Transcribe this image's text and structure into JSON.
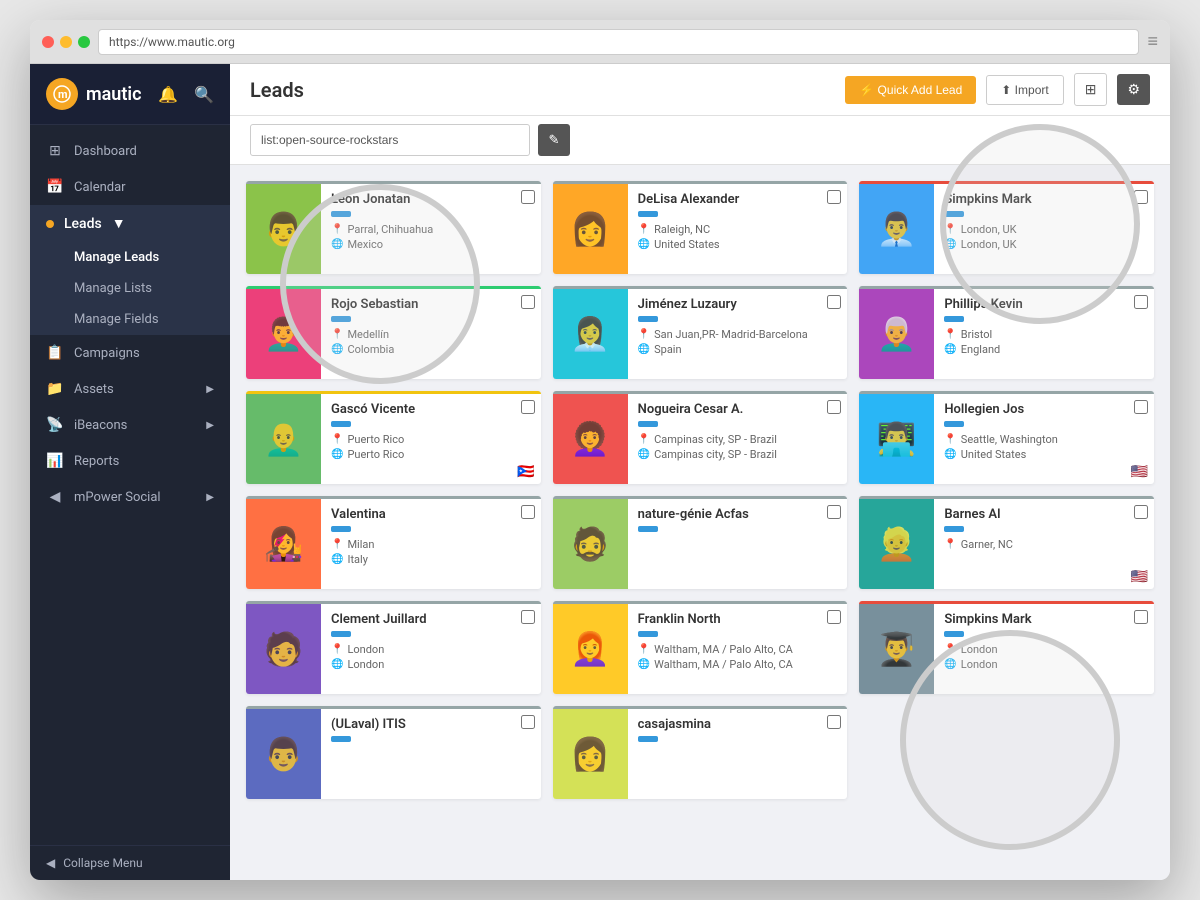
{
  "browser": {
    "url": "https://www.mautic.org"
  },
  "app": {
    "name": "mautic",
    "logo_letter": "m"
  },
  "header": {
    "title": "Leads",
    "quick_add_label": "⚡ Quick Add Lead",
    "import_label": "⬆ Import",
    "grid_icon": "⊞",
    "settings_icon": "⚙"
  },
  "search": {
    "value": "list:open-source-rockstars",
    "edit_icon": "✎"
  },
  "sidebar": {
    "logo": "mautic",
    "nav_items": [
      {
        "id": "dashboard",
        "label": "Dashboard",
        "icon": "⊞"
      },
      {
        "id": "calendar",
        "label": "Calendar",
        "icon": "📅"
      },
      {
        "id": "leads",
        "label": "Leads",
        "icon": "👤",
        "has_arrow": true,
        "active": true
      },
      {
        "id": "campaigns",
        "label": "Campaigns",
        "icon": "📋"
      },
      {
        "id": "assets",
        "label": "Assets",
        "icon": "📁",
        "has_arrow": true
      },
      {
        "id": "ibeacons",
        "label": "iBeacons",
        "icon": "📡",
        "has_arrow": true
      },
      {
        "id": "reports",
        "label": "Reports",
        "icon": "📊"
      },
      {
        "id": "mpower-social",
        "label": "mPower Social",
        "icon": "◀",
        "has_arrow": true
      }
    ],
    "leads_sub": [
      {
        "id": "manage-leads",
        "label": "Manage Leads",
        "active": true
      },
      {
        "id": "manage-lists",
        "label": "Manage Lists",
        "active": false
      },
      {
        "id": "manage-fields",
        "label": "Manage Fields",
        "active": false
      }
    ],
    "collapse_label": "Collapse Menu"
  },
  "leads": [
    {
      "id": 1,
      "name": "Leon Jonatan",
      "city": "Parral, Chihuahua",
      "country": "Mexico",
      "border": "border-gray",
      "flag": ""
    },
    {
      "id": 2,
      "name": "DeLisa Alexander",
      "city": "Raleigh, NC",
      "country": "United States",
      "border": "border-gray",
      "flag": ""
    },
    {
      "id": 3,
      "name": "Simpkins Mark",
      "city": "London, UK",
      "country": "London, UK",
      "border": "border-red",
      "flag": ""
    },
    {
      "id": 4,
      "name": "Rojo Sebastian",
      "city": "Medellín",
      "country": "Colombia",
      "border": "border-green",
      "flag": ""
    },
    {
      "id": 5,
      "name": "Jiménez Luzaury",
      "city": "San Juan,PR- Madrid-Barcelona",
      "country": "Spain",
      "border": "border-gray",
      "flag": ""
    },
    {
      "id": 6,
      "name": "Phillips Kevin",
      "city": "Bristol",
      "country": "England",
      "border": "border-gray",
      "flag": ""
    },
    {
      "id": 7,
      "name": "Gascó Vicente",
      "city": "Puerto Rico",
      "country": "Puerto Rico",
      "border": "border-yellow",
      "flag": "🇵🇷"
    },
    {
      "id": 8,
      "name": "Nogueira Cesar A.",
      "city": "Campinas city, SP - Brazil",
      "country": "Campinas city, SP - Brazil",
      "border": "border-gray",
      "flag": ""
    },
    {
      "id": 9,
      "name": "Hollegien Jos",
      "city": "Seattle, Washington",
      "country": "United States",
      "border": "border-gray",
      "flag": "🇺🇸"
    },
    {
      "id": 10,
      "name": "Valentina",
      "city": "Milan",
      "country": "Italy",
      "border": "border-gray",
      "flag": ""
    },
    {
      "id": 11,
      "name": "nature-génie Acfas",
      "city": "",
      "country": "",
      "border": "border-gray",
      "flag": ""
    },
    {
      "id": 12,
      "name": "Barnes Al",
      "city": "Garner, NC",
      "country": "",
      "border": "border-gray",
      "flag": "🇺🇸"
    },
    {
      "id": 13,
      "name": "Clement Juillard",
      "city": "London",
      "country": "London",
      "border": "border-gray",
      "flag": ""
    },
    {
      "id": 14,
      "name": "Franklin North",
      "city": "Waltham, MA / Palo Alto, CA",
      "country": "Waltham, MA / Palo Alto, CA",
      "border": "border-gray",
      "flag": ""
    },
    {
      "id": 15,
      "name": "Simpkins Mark",
      "city": "London",
      "country": "London",
      "border": "border-red",
      "flag": ""
    },
    {
      "id": 16,
      "name": "(ULaval) ITIS",
      "city": "",
      "country": "",
      "border": "border-gray",
      "flag": ""
    },
    {
      "id": 17,
      "name": "casajasmina",
      "city": "",
      "country": "",
      "border": "border-gray",
      "flag": ""
    }
  ],
  "avatar_colors": [
    "#8BC34A",
    "#FFA726",
    "#42A5F5",
    "#EC407A",
    "#26C6DA",
    "#AB47BC",
    "#66BB6A",
    "#EF5350",
    "#29B6F6",
    "#FF7043",
    "#9CCC65",
    "#26A69A",
    "#7E57C2",
    "#FFCA28",
    "#78909C",
    "#5C6BC0",
    "#D4E157"
  ]
}
